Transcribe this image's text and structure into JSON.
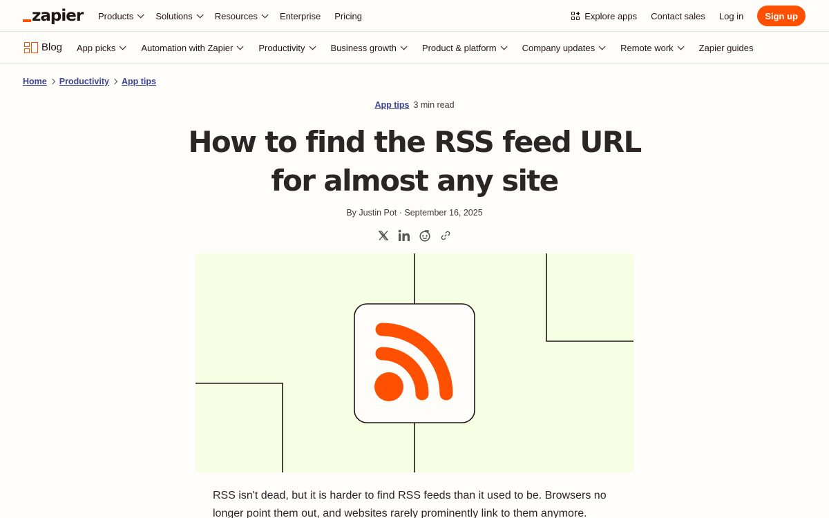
{
  "topnav": {
    "logo_text": "zapier",
    "links": [
      {
        "label": "Products",
        "dropdown": true
      },
      {
        "label": "Solutions",
        "dropdown": true
      },
      {
        "label": "Resources",
        "dropdown": true
      },
      {
        "label": "Enterprise",
        "dropdown": false
      },
      {
        "label": "Pricing",
        "dropdown": false
      }
    ],
    "explore_apps": "Explore apps",
    "contact_sales": "Contact sales",
    "log_in": "Log in",
    "sign_up": "Sign up"
  },
  "blognav": {
    "brand": "Blog",
    "links": [
      {
        "label": "App picks",
        "dropdown": true
      },
      {
        "label": "Automation with Zapier",
        "dropdown": true
      },
      {
        "label": "Productivity",
        "dropdown": true
      },
      {
        "label": "Business growth",
        "dropdown": true
      },
      {
        "label": "Product & platform",
        "dropdown": true
      },
      {
        "label": "Company updates",
        "dropdown": true
      },
      {
        "label": "Remote work",
        "dropdown": true
      },
      {
        "label": "Zapier guides",
        "dropdown": false
      }
    ]
  },
  "breadcrumb": [
    "Home",
    "Productivity",
    "App tips"
  ],
  "article": {
    "category": "App tips",
    "read_time": "3 min read",
    "title_line1": "How to find the RSS feed URL",
    "title_line2": "for almost any site",
    "byline": "By Justin Pot · September 16, 2025",
    "body_text": "RSS isn't dead, but it is harder to find RSS feeds than it used to be. Browsers no longer point them out, and websites rarely prominently link to them anymore."
  },
  "share_icons": [
    "x-icon",
    "linkedin-icon",
    "reddit-icon",
    "link-icon"
  ],
  "colors": {
    "brand": "#ff4f00",
    "link": "#3d4592",
    "hero_bg": "#f6ffe4",
    "text": "#201515"
  }
}
